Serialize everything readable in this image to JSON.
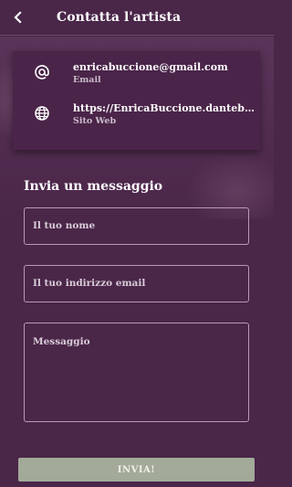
{
  "header": {
    "title": "Contatta l'artista",
    "back_icon": "chevron-left-icon"
  },
  "contacts": [
    {
      "icon": "at-sign-icon",
      "value": "enricabuccione@gmail.com",
      "label": "Email"
    },
    {
      "icon": "globe-icon",
      "value": "https://EnricaBuccione.dantebu...",
      "label": "Sito Web"
    }
  ],
  "form": {
    "title": "Invia un messaggio",
    "name_placeholder": "Il tuo nome",
    "email_placeholder": "Il tuo indirizzo email",
    "message_placeholder": "Messaggio",
    "submit_label": "INVIA!"
  },
  "colors": {
    "background": "#4a2649",
    "card": "#4a2449",
    "field_border": "#b79ab5",
    "button": "#a3aa99"
  }
}
